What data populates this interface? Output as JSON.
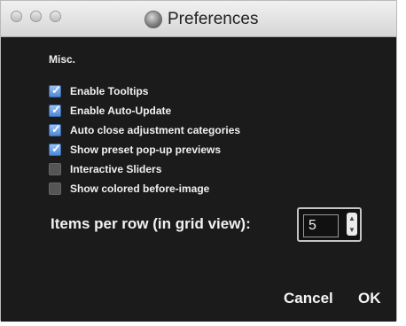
{
  "window": {
    "title": "Preferences"
  },
  "section": {
    "label": "Misc."
  },
  "options": [
    {
      "label": "Enable Tooltips",
      "checked": true
    },
    {
      "label": "Enable Auto-Update",
      "checked": true
    },
    {
      "label": "Auto close adjustment categories",
      "checked": true
    },
    {
      "label": "Show preset pop-up previews",
      "checked": true
    },
    {
      "label": "Interactive Sliders",
      "checked": false
    },
    {
      "label": "Show colored before-image",
      "checked": false
    }
  ],
  "items_per_row": {
    "label": "Items per row (in grid view):",
    "value": "5"
  },
  "buttons": {
    "cancel": "Cancel",
    "ok": "OK"
  },
  "colors": {
    "accent": "#4f88d6",
    "background": "#1b1b1b"
  }
}
